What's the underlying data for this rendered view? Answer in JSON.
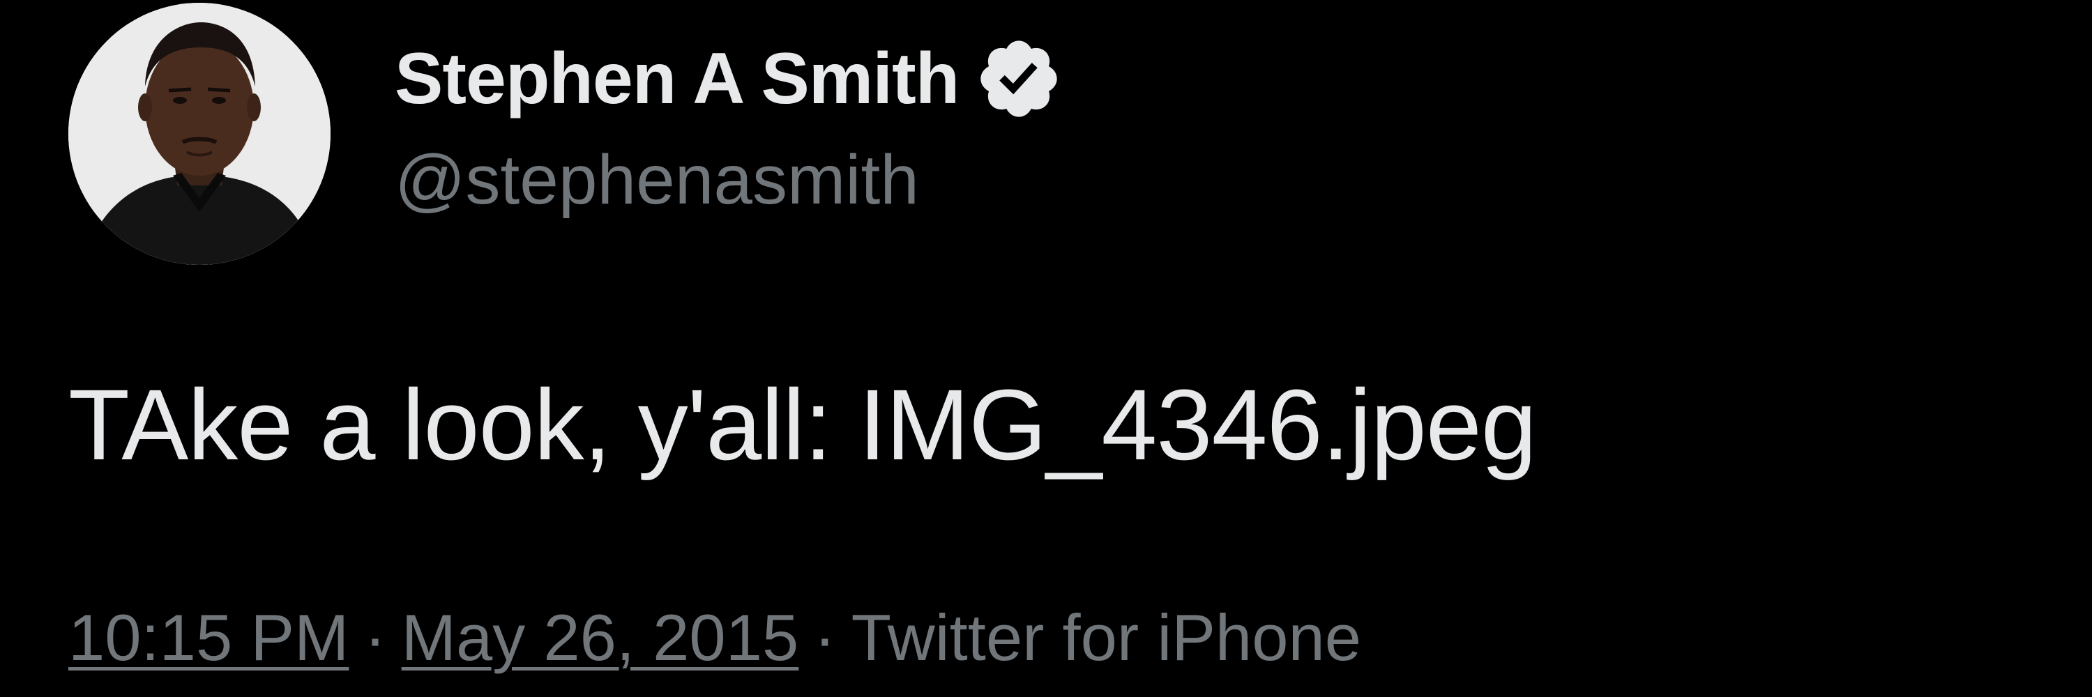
{
  "tweet": {
    "author": {
      "display_name": "Stephen A Smith",
      "handle": "@stephenasmith",
      "verified": true,
      "verified_icon": "verified-badge-icon"
    },
    "text": "TAke a look, y'all: IMG_4346.jpeg",
    "meta": {
      "time": "10:15 PM",
      "separator": "·",
      "date": "May 26, 2015",
      "source": "Twitter for iPhone"
    }
  },
  "colors": {
    "background": "#000000",
    "primary_text": "#e7e9ea",
    "secondary_text": "#71767b"
  }
}
